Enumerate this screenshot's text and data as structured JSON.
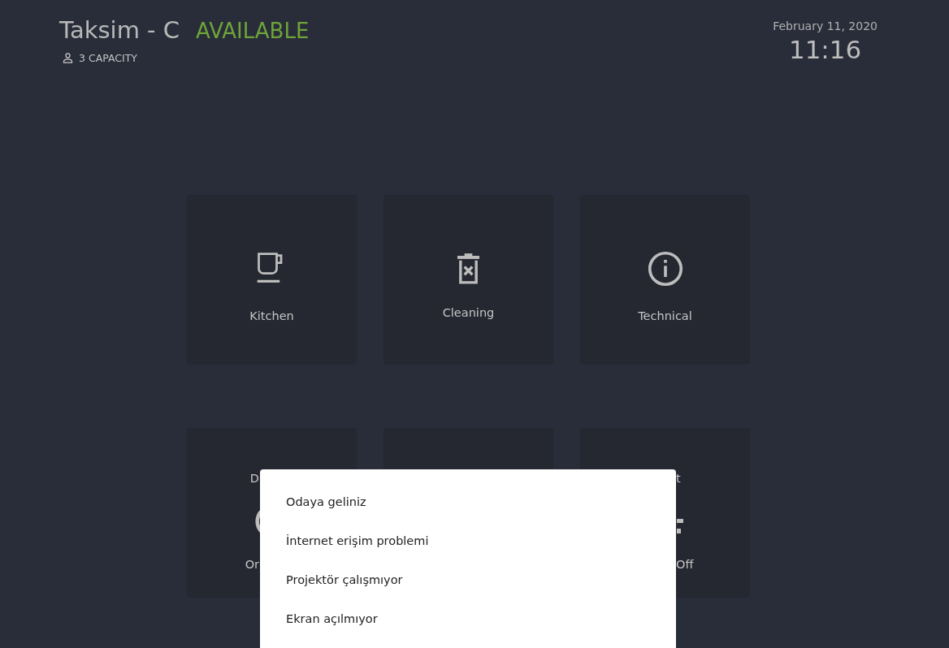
{
  "room": {
    "name": "Taksim - C",
    "status": "AVAILABLE",
    "capacity": "3 CAPACITY"
  },
  "clock": {
    "date": "February 11, 2020",
    "time": "11:16"
  },
  "tiles": [
    {
      "kind": "service",
      "label": "Kitchen"
    },
    {
      "kind": "service",
      "label": "Cleaning"
    },
    {
      "kind": "service",
      "label": "Technical"
    },
    {
      "kind": "control",
      "top_label": "D",
      "bottom_label": "Or"
    },
    {
      "kind": "control"
    },
    {
      "kind": "control",
      "top_label": "t",
      "bottom_label": "Off"
    }
  ],
  "menu": {
    "items": [
      "Odaya geliniz",
      "İnternet erişim problemi",
      "Projektör çalışmıyor",
      "Ekran açılmıyor"
    ]
  }
}
